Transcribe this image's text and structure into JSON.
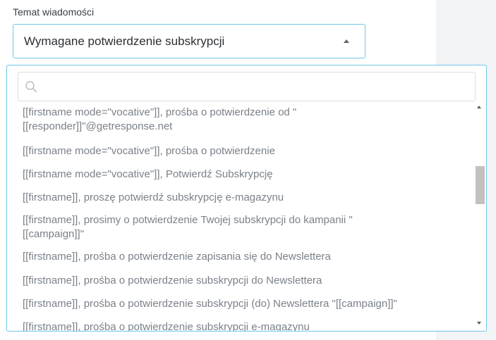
{
  "field": {
    "label": "Temat wiadomości",
    "selected_value": "Wymagane potwierdzenie subskrypcji"
  },
  "dropdown": {
    "search": {
      "value": "",
      "placeholder": ""
    },
    "items": [
      {
        "label": "[[firstname mode=\"vocative\"]], prośba o potwierdzenie od \"\n[[responder]]\"@getresponse.net"
      },
      {
        "label": "[[firstname mode=\"vocative\"]], prośba o potwierdzenie"
      },
      {
        "label": "[[firstname mode=\"vocative\"]], Potwierdź Subskrypcję"
      },
      {
        "label": "[[firstname]], proszę potwierdź subskrypcję e-magazynu"
      },
      {
        "label": "[[firstname]], prosimy o potwierdzenie Twojej subskrypcji do kampanii \"\n[[campaign]]\""
      },
      {
        "label": "[[firstname]], prośba o potwierdzenie zapisania się do Newslettera"
      },
      {
        "label": "[[firstname]], prośba o potwierdzenie subskrypcji do Newslettera"
      },
      {
        "label": "[[firstname]], prośba o potwierdzenie subskrypcji (do) Newslettera \"[[campaign]]\""
      },
      {
        "label": "[[firstname]], prośba o potwierdzenie subskrypcji e-magazynu"
      }
    ]
  },
  "icons": {
    "search": "search-icon",
    "caret": "chevron-up-icon",
    "scroll_up": "scroll-up-arrow-icon",
    "scroll_down": "scroll-down-arrow-icon"
  },
  "colors": {
    "accent_border": "#6fc6ea",
    "item_text": "#7a8189",
    "side_panel": "#f3f4f6"
  }
}
